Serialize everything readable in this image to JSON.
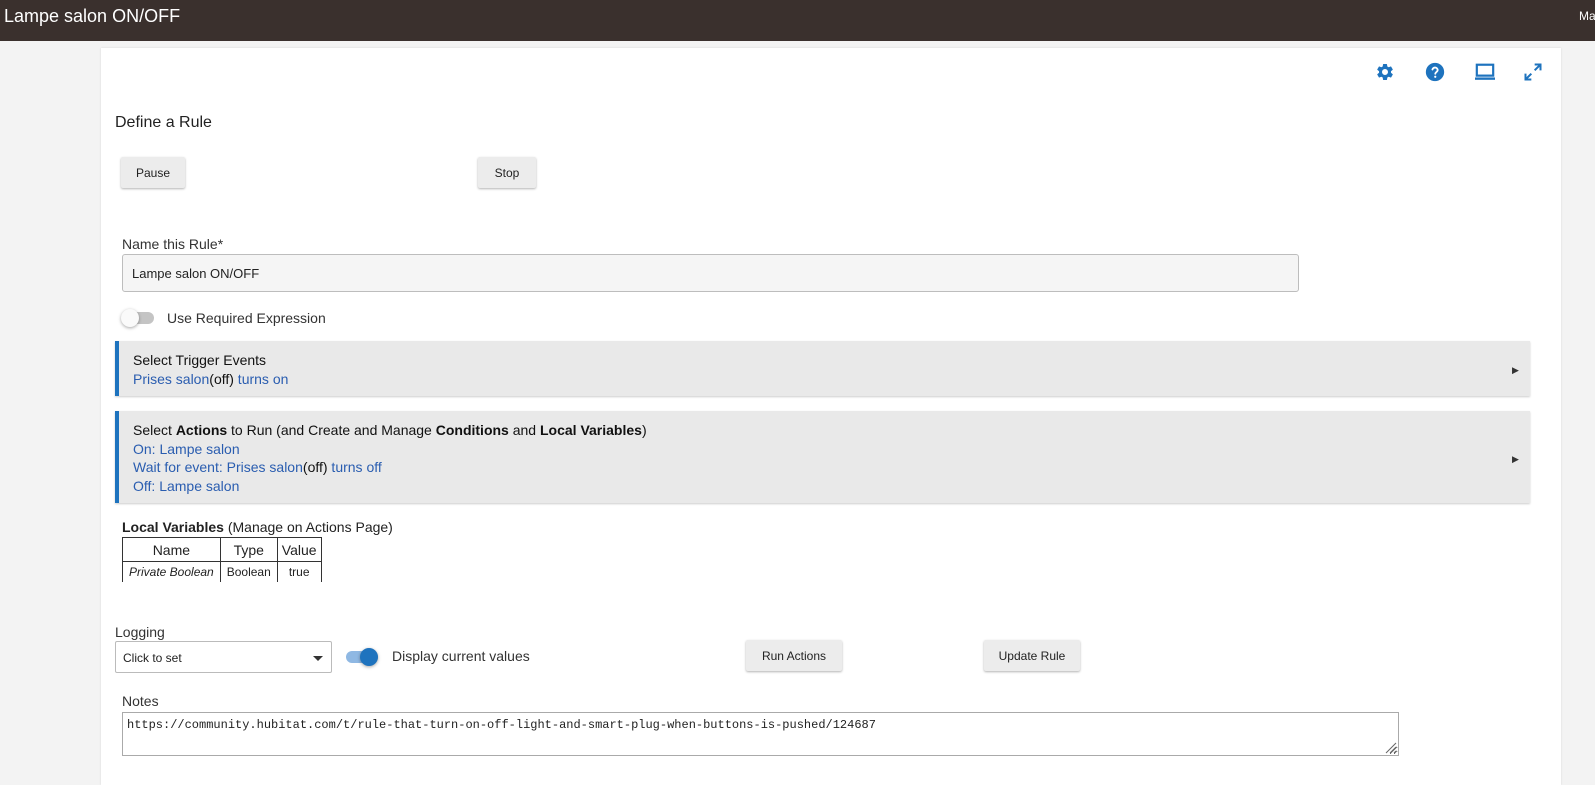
{
  "window": {
    "title": "Lampe salon ON/OFF",
    "user_truncated": "Ma"
  },
  "toolbar_icons": [
    "gear-icon",
    "help-icon",
    "laptop-icon",
    "fullscreen-icon"
  ],
  "accent_color": "#1e73be",
  "page": {
    "title": "Define a Rule",
    "pause_label": "Pause",
    "stop_label": "Stop",
    "name_label": "Name this Rule*",
    "name_value": "Lampe salon ON/OFF",
    "required_expression_label": "Use Required Expression",
    "required_expression_on": false
  },
  "triggers": {
    "heading": "Select Trigger Events",
    "line_device": "Prises salon",
    "line_paren_open": "(",
    "line_state": "off",
    "line_paren_close": ")",
    "line_suffix": " turns on"
  },
  "actions": {
    "heading_1": "Select ",
    "heading_actions": "Actions",
    "heading_2": " to Run (and Create and Manage ",
    "heading_conditions": "Conditions",
    "heading_3": " and ",
    "heading_local": "Local Variables",
    "heading_4": ")",
    "line1": "On: Lampe salon",
    "line2_prefix": "Wait for event: Prises salon",
    "line2_paren_open": "(",
    "line2_state": "off",
    "line2_paren_close": ")",
    "line2_suffix": " turns off",
    "line3": "Off: Lampe salon"
  },
  "local_variables": {
    "title_bold": "Local Variables",
    "title_rest": " (Manage on Actions Page)",
    "headers": [
      "Name",
      "Type",
      "Value"
    ],
    "rows": [
      [
        "Private Boolean",
        "Boolean",
        "true"
      ]
    ]
  },
  "logging": {
    "label": "Logging",
    "selected": "Click to set"
  },
  "display_values": {
    "label": "Display current values",
    "on": true
  },
  "run_actions_label": "Run Actions",
  "update_rule_label": "Update Rule",
  "notes": {
    "label": "Notes",
    "value": "https://community.hubitat.com/t/rule-that-turn-on-off-light-and-smart-plug-when-buttons-is-pushed/124687"
  },
  "section_arrow": "▶"
}
